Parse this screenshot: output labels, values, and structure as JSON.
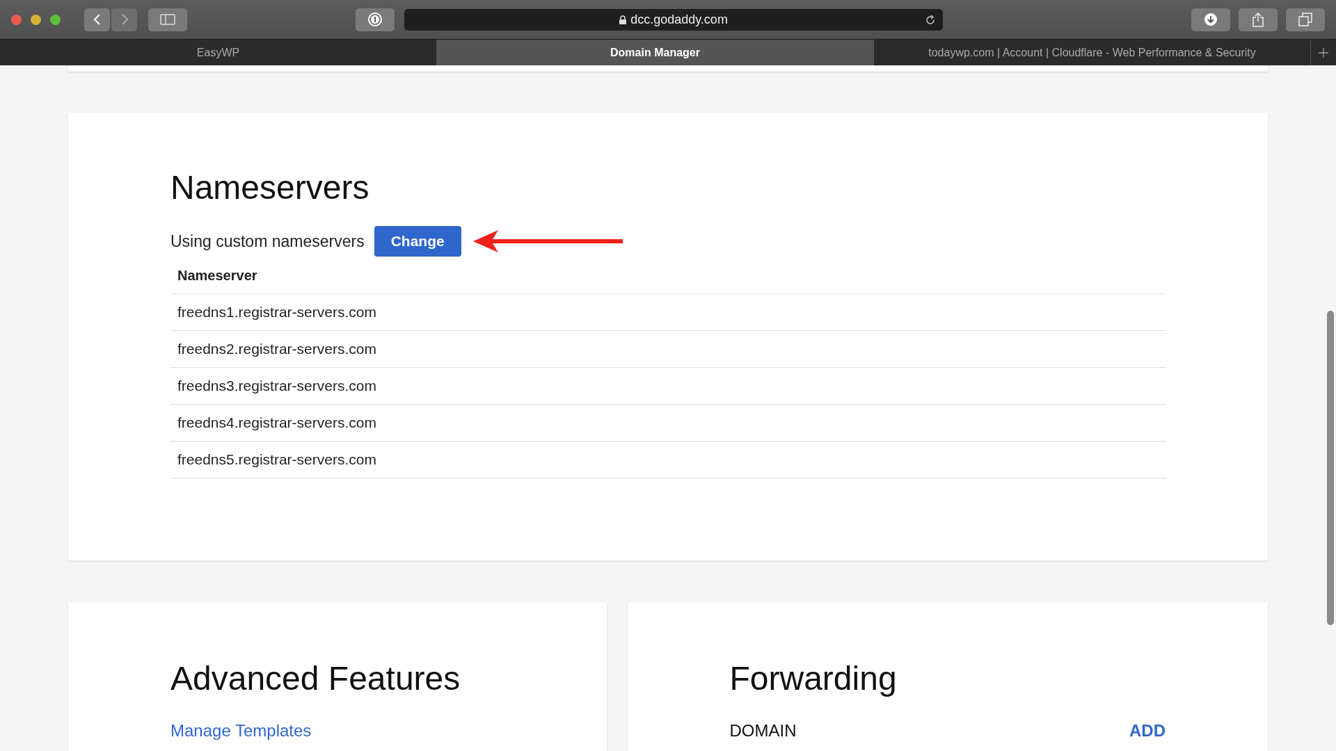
{
  "browser": {
    "url": "dcc.godaddy.com",
    "tabs": [
      {
        "label": "EasyWP",
        "selected": false
      },
      {
        "label": "Domain Manager",
        "selected": true
      },
      {
        "label": "todaywp.com | Account | Cloudflare - Web Performance & Security",
        "selected": false
      }
    ]
  },
  "nameservers": {
    "title": "Nameservers",
    "status_text": "Using custom nameservers",
    "change_button": "Change",
    "column_header": "Nameserver",
    "rows": [
      "freedns1.registrar-servers.com",
      "freedns2.registrar-servers.com",
      "freedns3.registrar-servers.com",
      "freedns4.registrar-servers.com",
      "freedns5.registrar-servers.com"
    ]
  },
  "advanced_features": {
    "title": "Advanced Features",
    "link": "Manage Templates"
  },
  "forwarding": {
    "title": "Forwarding",
    "label": "DOMAIN",
    "add_link": "ADD"
  }
}
